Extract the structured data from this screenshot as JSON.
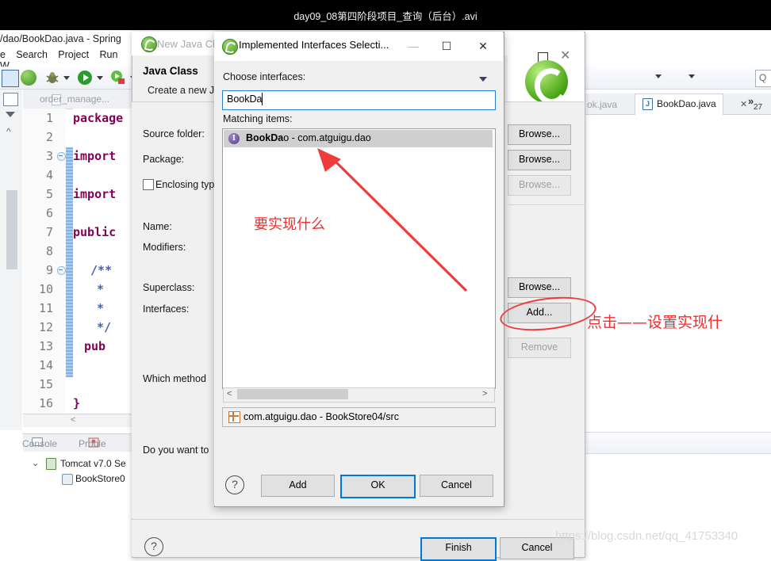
{
  "video": {
    "title": "day09_08第四阶段项目_查询（后台）.avi"
  },
  "ide": {
    "title": "/dao/BookDao.java - Spring",
    "menus": [
      {
        "label": "e"
      },
      {
        "label": "Search"
      },
      {
        "label": "Project"
      },
      {
        "label": "Run"
      },
      {
        "label": "W"
      }
    ],
    "editor_tab_inactive": "order_manage...",
    "code_lines": [
      {
        "n": "1",
        "text": "package",
        "kind": "kw",
        "fold": false
      },
      {
        "n": "2",
        "text": "",
        "kind": "",
        "fold": false
      },
      {
        "n": "3",
        "text": "import",
        "kind": "kw",
        "fold": true
      },
      {
        "n": "4",
        "text": "",
        "kind": "",
        "fold": false
      },
      {
        "n": "5",
        "text": "import",
        "kind": "kw",
        "fold": false
      },
      {
        "n": "6",
        "text": "",
        "kind": "",
        "fold": false
      },
      {
        "n": "7",
        "text": "public",
        "kind": "kw",
        "fold": false
      },
      {
        "n": "8",
        "text": "",
        "kind": "",
        "fold": false
      },
      {
        "n": "9",
        "text": "/**",
        "kind": "cm",
        "fold": true
      },
      {
        "n": "10",
        "text": "*",
        "kind": "cm",
        "fold": false
      },
      {
        "n": "11",
        "text": "*",
        "kind": "cm",
        "fold": false
      },
      {
        "n": "12",
        "text": "*/",
        "kind": "cm",
        "fold": false
      },
      {
        "n": "13",
        "text": "pub",
        "kind": "kw",
        "fold": false
      },
      {
        "n": "14",
        "text": "",
        "kind": "",
        "fold": false
      },
      {
        "n": "15",
        "text": "",
        "kind": "",
        "fold": false
      },
      {
        "n": "16",
        "text": "}",
        "kind": "kw",
        "fold": false
      }
    ],
    "console": {
      "tab_console": "Console",
      "tab_problems": "Proble",
      "tree": [
        {
          "label": "Tomcat v7.0 Se"
        },
        {
          "label": "BookStore0"
        }
      ]
    },
    "right_tabs": {
      "inactive": "ok.java",
      "active": "BookDao.java",
      "active_icon_letter": "J",
      "close_glyph": "✕",
      "overflow": "»",
      "overflow_count": "27"
    }
  },
  "new_java_class": {
    "window_title": "New Java Cl",
    "heading": "Java Class",
    "subheading": "Create a new J",
    "labels": {
      "source_folder": "Source folder:",
      "package": "Package:",
      "enclosing_type": "Enclosing typ",
      "name": "Name:",
      "modifiers": "Modifiers:",
      "superclass": "Superclass:",
      "interfaces": "Interfaces:",
      "which_method": "Which method",
      "do_you_want": "Do you want to"
    },
    "buttons": {
      "browse1": "Browse...",
      "browse2": "Browse...",
      "browse3": "Browse...",
      "browse4": "Browse...",
      "add": "Add...",
      "remove": "Remove",
      "finish": "Finish",
      "cancel": "Cancel",
      "help": "?"
    },
    "window_controls": {
      "maximize": "☐",
      "close": "✕"
    }
  },
  "interfaces_dialog": {
    "title": "Implemented Interfaces Selecti...",
    "choose_label": "Choose interfaces:",
    "filter_value": "BookDa",
    "matching_label": "Matching items:",
    "match_item": {
      "bold": "BookDa",
      "rest": "o - com.atguigu.dao",
      "icon_letter": "I"
    },
    "qualifier": "com.atguigu.dao - BookStore04/src",
    "buttons": {
      "help": "?",
      "add": "Add",
      "ok": "OK",
      "cancel": "Cancel"
    },
    "window_controls": {
      "minimize": "—",
      "maximize": "☐",
      "close": "✕"
    }
  },
  "annotations": {
    "what_to_implement": "要实现什么",
    "click_to_set": "点击——设置实现什",
    "watermark": "https://blog.csdn.net/qq_41753340"
  },
  "colors": {
    "accent_blue": "#0078d7",
    "annotation_red": "#f02c2c",
    "keyword_purple": "#7f0055",
    "comment_blue": "#3f5fbf",
    "interface_purple": "#5b3f93"
  }
}
